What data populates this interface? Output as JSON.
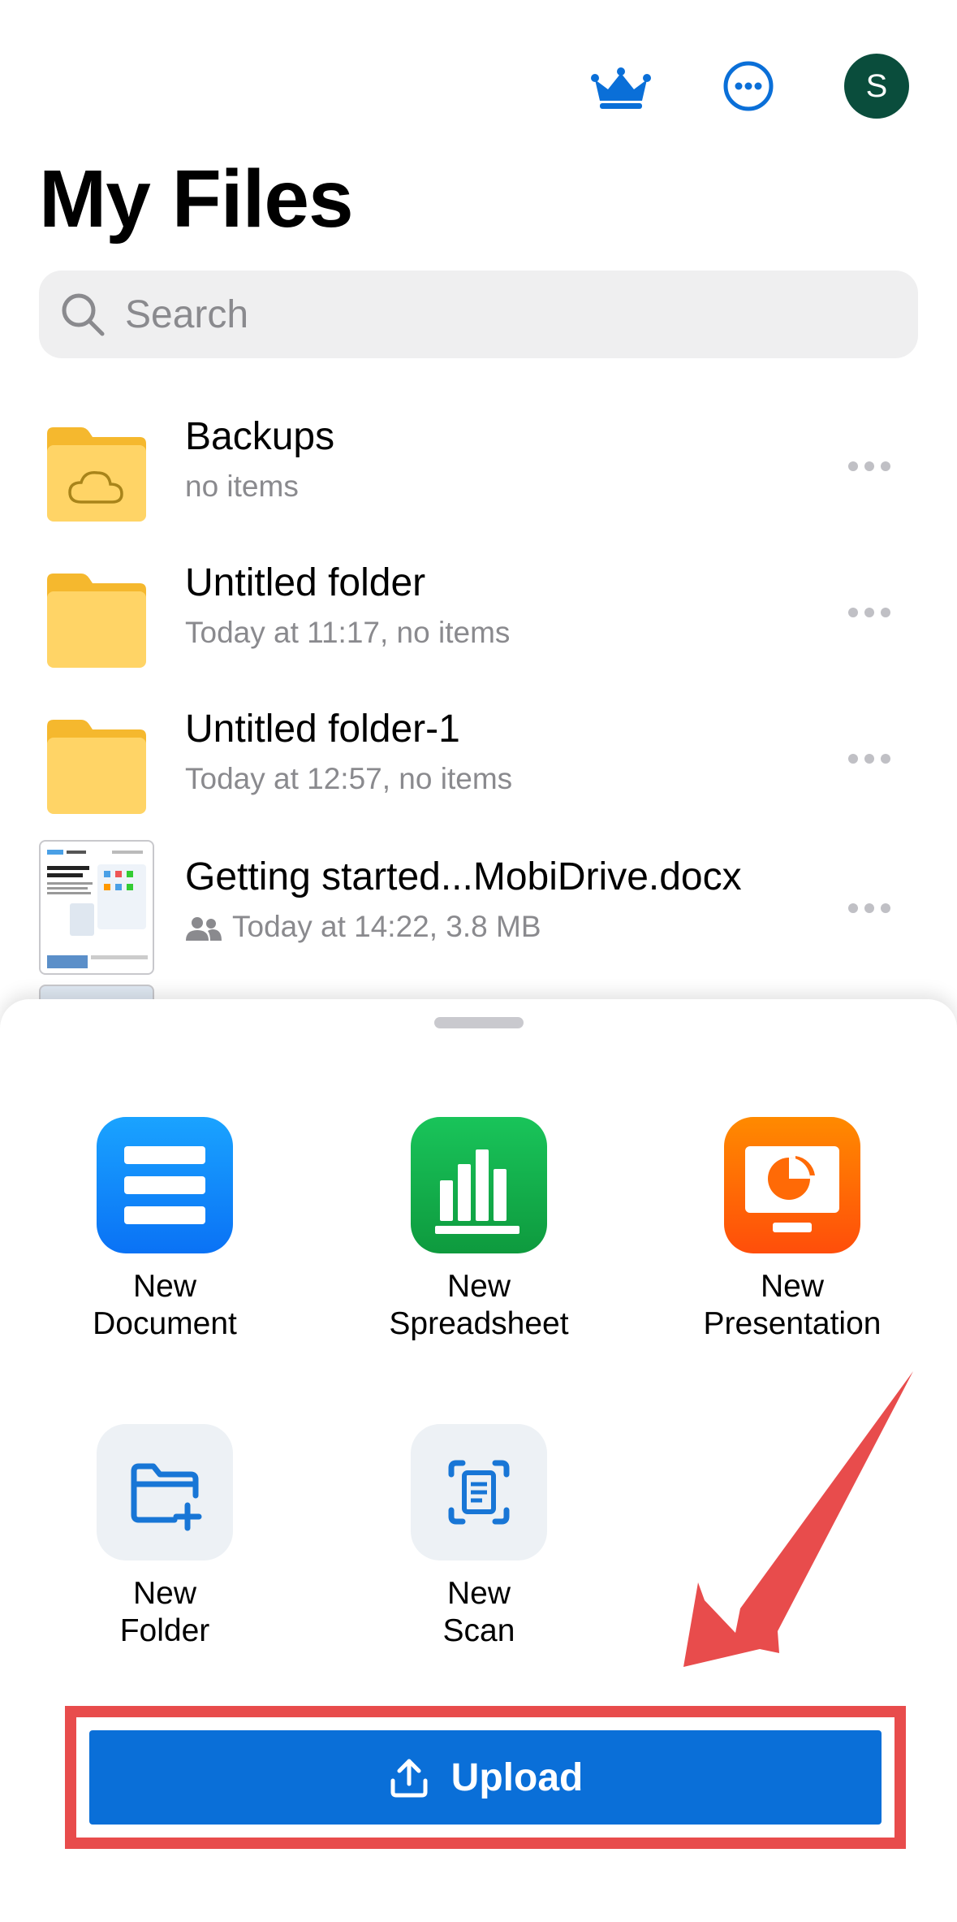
{
  "header": {
    "title": "My Files",
    "avatar_initial": "S",
    "crown_icon": "crown-icon",
    "more_icon": "more-circle-icon"
  },
  "search": {
    "placeholder": "Search"
  },
  "files": [
    {
      "name": "Backups",
      "meta": "no items",
      "type": "cloud-folder"
    },
    {
      "name": "Untitled folder",
      "meta": "Today at 11:17, no items",
      "type": "folder"
    },
    {
      "name": "Untitled folder-1",
      "meta": "Today at 12:57, no items",
      "type": "folder"
    },
    {
      "name": "Getting started...MobiDrive.docx",
      "meta": "Today at 14:22, 3.8 MB",
      "type": "document",
      "shared": true
    }
  ],
  "sheet": {
    "actions": [
      {
        "label_line1": "New",
        "label_line2": "Document",
        "icon": "document-icon"
      },
      {
        "label_line1": "New",
        "label_line2": "Spreadsheet",
        "icon": "spreadsheet-icon"
      },
      {
        "label_line1": "New",
        "label_line2": "Presentation",
        "icon": "presentation-icon"
      },
      {
        "label_line1": "New",
        "label_line2": "Folder",
        "icon": "new-folder-icon"
      },
      {
        "label_line1": "New",
        "label_line2": "Scan",
        "icon": "scan-icon"
      }
    ],
    "upload_label": "Upload"
  },
  "colors": {
    "accent": "#0a6fd8",
    "folder": "#ffd466",
    "highlight": "#e84c4c",
    "avatar": "#0a4d3c"
  }
}
